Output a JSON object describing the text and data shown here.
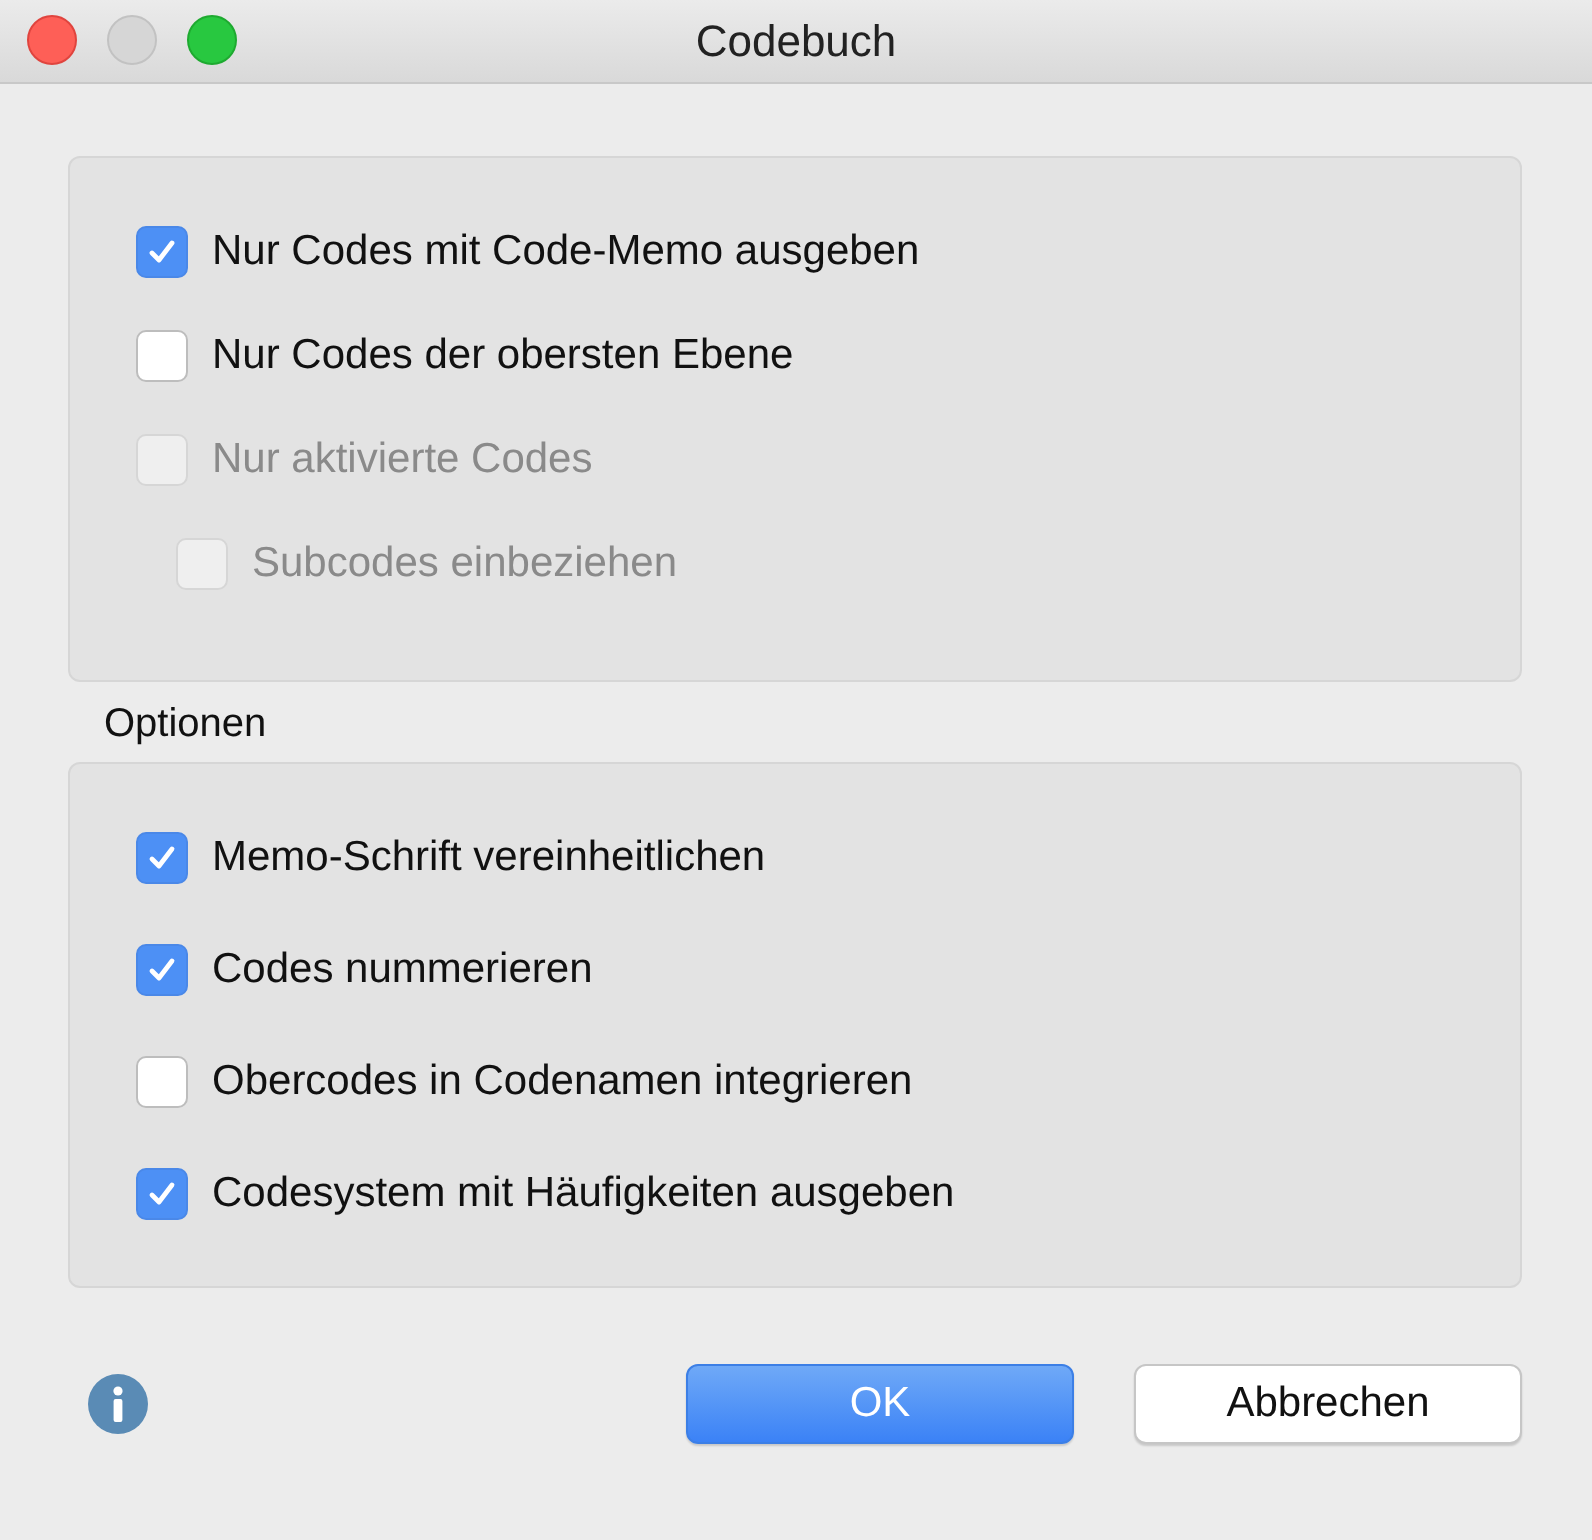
{
  "window": {
    "title": "Codebuch"
  },
  "filters": [
    {
      "label": "Nur Codes mit Code-Memo ausgeben",
      "checked": true,
      "disabled": false
    },
    {
      "label": "Nur Codes der obersten Ebene",
      "checked": false,
      "disabled": false
    },
    {
      "label": "Nur aktivierte Codes",
      "checked": false,
      "disabled": true,
      "children": [
        {
          "label": "Subcodes einbeziehen",
          "checked": false,
          "disabled": true
        }
      ]
    }
  ],
  "options": {
    "title": "Optionen",
    "items": [
      {
        "label": "Memo-Schrift vereinheitlichen",
        "checked": true,
        "disabled": false
      },
      {
        "label": "Codes nummerieren",
        "checked": true,
        "disabled": false
      },
      {
        "label": "Obercodes in Codenamen integrieren",
        "checked": false,
        "disabled": false
      },
      {
        "label": "Codesystem mit Häufigkeiten ausgeben",
        "checked": true,
        "disabled": false
      }
    ]
  },
  "buttons": [
    {
      "label": "OK",
      "kind": "primary"
    },
    {
      "label": "Abbrechen",
      "kind": "secondary"
    }
  ]
}
